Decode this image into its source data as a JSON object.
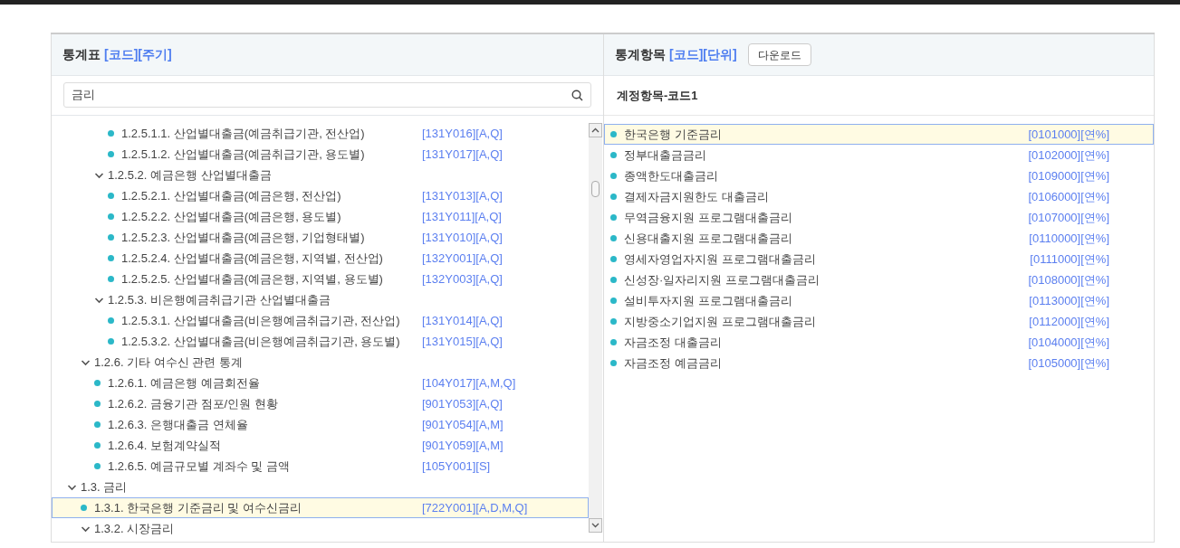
{
  "left_panel": {
    "title": "통계표",
    "title_links": [
      "[코드]",
      "[주기]"
    ],
    "search": {
      "value": "금리"
    },
    "tree": [
      {
        "children": [
          {
            "children": [
              {
                "children": [
                  {
                    "label": "1.2.5.1.1. 산업별대출금(예금취급기관, 전산업)",
                    "code": "[131Y016][A,Q]",
                    "selected": false
                  },
                  {
                    "label": "1.2.5.1.2. 산업별대출금(예금취급기관, 용도별)",
                    "code": "[131Y017][A,Q]",
                    "selected": false
                  }
                ]
              },
              {
                "label": "1.2.5.2. 예금은행 산업별대출금",
                "expanded": true,
                "selected": false,
                "children": [
                  {
                    "label": "1.2.5.2.1. 산업별대출금(예금은행, 전산업)",
                    "code": "[131Y013][A,Q]",
                    "selected": false
                  },
                  {
                    "label": "1.2.5.2.2. 산업별대출금(예금은행, 용도별)",
                    "code": "[131Y011][A,Q]",
                    "selected": false
                  },
                  {
                    "label": "1.2.5.2.3. 산업별대출금(예금은행, 기업형태별)",
                    "code": "[131Y010][A,Q]",
                    "selected": false
                  },
                  {
                    "label": "1.2.5.2.4. 산업별대출금(예금은행, 지역별, 전산업)",
                    "code": "[132Y001][A,Q]",
                    "selected": false
                  },
                  {
                    "label": "1.2.5.2.5. 산업별대출금(예금은행, 지역별, 용도별)",
                    "code": "[132Y003][A,Q]",
                    "selected": false
                  }
                ]
              },
              {
                "label": "1.2.5.3. 비은행예금취급기관 산업별대출금",
                "expanded": true,
                "selected": false,
                "children": [
                  {
                    "label": "1.2.5.3.1. 산업별대출금(비은행예금취급기관, 전산업)",
                    "code": "[131Y014][A,Q]",
                    "selected": false
                  },
                  {
                    "label": "1.2.5.3.2. 산업별대출금(비은행예금취급기관, 용도별)",
                    "code": "[131Y015][A,Q]",
                    "selected": false
                  }
                ]
              }
            ]
          },
          {
            "label": "1.2.6. 기타 여수신 관련 통계",
            "expanded": true,
            "selected": false,
            "children": [
              {
                "label": "1.2.6.1. 예금은행 예금회전율",
                "code": "[104Y017][A,M,Q]",
                "selected": false
              },
              {
                "label": "1.2.6.2. 금융기관 점포/인원 현황",
                "code": "[901Y053][A,Q]",
                "selected": false
              },
              {
                "label": "1.2.6.3. 은행대출금 연체율",
                "code": "[901Y054][A,M]",
                "selected": false
              },
              {
                "label": "1.2.6.4. 보험계약실적",
                "code": "[901Y059][A,M]",
                "selected": false
              },
              {
                "label": "1.2.6.5. 예금규모별 계좌수 및 금액",
                "code": "[105Y001][S]",
                "selected": false
              }
            ]
          }
        ]
      },
      {
        "label": "1.3. 금리",
        "expanded": true,
        "selected": false,
        "children": [
          {
            "label": "1.3.1. 한국은행 기준금리 및 여수신금리",
            "code": "[722Y001][A,D,M,Q]",
            "selected": true
          },
          {
            "label": "1.3.2. 시장금리",
            "expanded": true,
            "selected": false
          }
        ]
      }
    ]
  },
  "right_panel": {
    "title": "통계항목",
    "title_links": [
      "[코드]",
      "[단위]"
    ],
    "download_button": "다운로드",
    "subheader": "계정항목-코드1",
    "items": [
      {
        "label": "한국은행 기준금리",
        "code": "[0101000][연%]",
        "selected": true
      },
      {
        "label": "정부대출금금리",
        "code": "[0102000][연%]",
        "selected": false
      },
      {
        "label": "종액한도대출금리",
        "code": "[0109000][연%]",
        "selected": false
      },
      {
        "label": "결제자금지원한도 대출금리",
        "code": "[0106000][연%]",
        "selected": false
      },
      {
        "label": "무역금융지원 프로그램대출금리",
        "code": "[0107000][연%]",
        "selected": false
      },
      {
        "label": "신용대출지원 프로그램대출금리",
        "code": "[0110000][연%]",
        "selected": false
      },
      {
        "label": "영세자영업자지원 프로그램대출금리",
        "code": "[0111000][연%]",
        "selected": false
      },
      {
        "label": "신성장·일자리지원 프로그램대출금리",
        "code": "[0108000][연%]",
        "selected": false
      },
      {
        "label": "설비투자지원 프로그램대출금리",
        "code": "[0113000][연%]",
        "selected": false
      },
      {
        "label": "지방중소기업지원 프로그램대출금리",
        "code": "[0112000][연%]",
        "selected": false
      },
      {
        "label": "자금조정 대출금리",
        "code": "[0104000][연%]",
        "selected": false
      },
      {
        "label": "자금조정 예금금리",
        "code": "[0105000][연%]",
        "selected": false
      }
    ]
  }
}
